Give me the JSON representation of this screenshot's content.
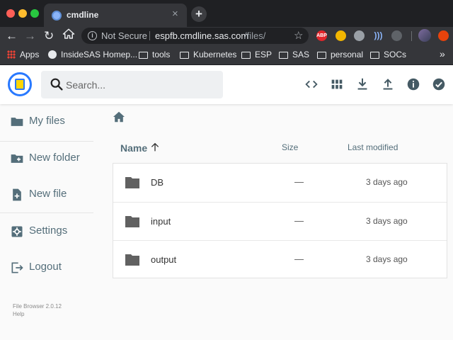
{
  "browser": {
    "tab_title": "cmdline",
    "tab_close": "×",
    "new_tab": "+",
    "security_label": "Not Secure",
    "url_host": "espfb.cmdline.sas.com",
    "url_path": "/files/",
    "extension_badge": "ABP",
    "bookmarks": [
      {
        "label": "Apps",
        "icon": "apps-grid-icon"
      },
      {
        "label": "InsideSAS Homep...",
        "icon": "globe-icon"
      },
      {
        "label": "tools",
        "icon": "folder-icon"
      },
      {
        "label": "Kubernetes",
        "icon": "folder-icon"
      },
      {
        "label": "ESP",
        "icon": "folder-icon"
      },
      {
        "label": "SAS",
        "icon": "folder-icon"
      },
      {
        "label": "personal",
        "icon": "folder-icon"
      },
      {
        "label": "SOCs",
        "icon": "folder-icon"
      }
    ],
    "bookmarks_more": "»"
  },
  "header": {
    "search_placeholder": "Search...",
    "actions": [
      "code-view-icon",
      "grid-view-icon",
      "download-icon",
      "upload-icon",
      "info-icon",
      "check-circle-icon"
    ]
  },
  "sidebar": {
    "items": [
      {
        "label": "My files",
        "icon": "folder-icon"
      },
      {
        "label": "New folder",
        "icon": "create-folder-icon"
      },
      {
        "label": "New file",
        "icon": "note-add-icon"
      },
      {
        "label": "Settings",
        "icon": "settings-icon"
      },
      {
        "label": "Logout",
        "icon": "logout-icon"
      }
    ],
    "footer": {
      "version": "File Browser 2.0.12",
      "help": "Help"
    }
  },
  "listing": {
    "columns": {
      "name": "Name",
      "size": "Size",
      "modified": "Last modified"
    },
    "sort_icon": "arrow-upward-icon",
    "rows": [
      {
        "name": "DB",
        "size": "—",
        "modified": "3 days ago"
      },
      {
        "name": "input",
        "size": "—",
        "modified": "3 days ago"
      },
      {
        "name": "output",
        "size": "—",
        "modified": "3 days ago"
      }
    ]
  },
  "colors": {
    "accent": "#2979ff",
    "icon": "#546e7a",
    "chrome_dark": "#35363a"
  }
}
